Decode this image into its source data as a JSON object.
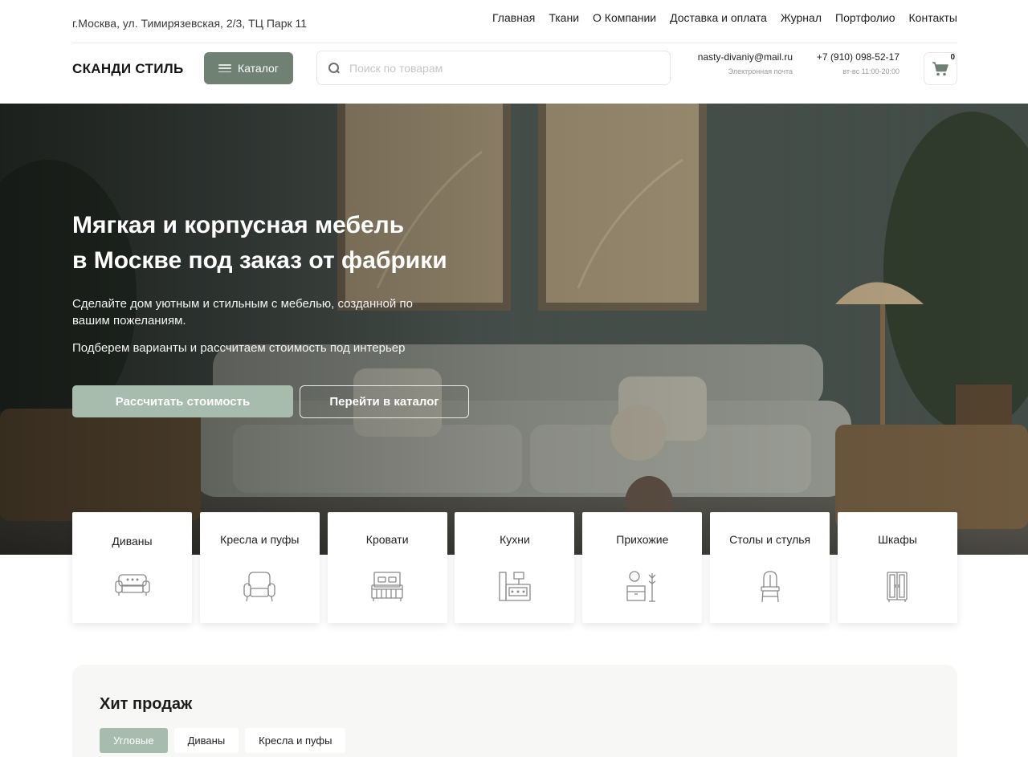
{
  "topbar": {
    "address": "г.Москва, ул. Тимирязевская, 2/3, ТЦ Парк 11",
    "nav": [
      "Главная",
      "Ткани",
      "О Компании",
      "Доставка и оплата",
      "Журнал",
      "Портфолио",
      "Контакты"
    ]
  },
  "header": {
    "logo": "СКАНДИ СТИЛЬ",
    "catalog_label": "Каталог",
    "search_placeholder": "Поиск по товарам",
    "email": "nasty-divaniy@mail.ru",
    "email_caption": "Электронная почта",
    "phone": "+7 (910) 098-52-17",
    "phone_caption": "вт-вс 11:00-20:00",
    "cart_count": "0"
  },
  "hero": {
    "title_line1": "Мягкая и корпусная мебель",
    "title_line2": "в Москве под заказ от фабрики",
    "subtitle": "Сделайте дом уютным и стильным с мебелью, созданной по вашим пожеланиям.",
    "subtitle2": "Подберем варианты и рассчитаем стоимость под интерьер",
    "btn_primary": "Рассчитать стоимость",
    "btn_secondary": "Перейти в каталог"
  },
  "categories": [
    {
      "label": "Диваны",
      "icon": "sofa-icon"
    },
    {
      "label": "Кресла и пуфы",
      "icon": "armchair-icon"
    },
    {
      "label": "Кровати",
      "icon": "bed-icon"
    },
    {
      "label": "Кухни",
      "icon": "kitchen-icon"
    },
    {
      "label": "Прихожие",
      "icon": "hallway-icon"
    },
    {
      "label": "Столы и стулья",
      "icon": "chair-icon"
    },
    {
      "label": "Шкафы",
      "icon": "wardrobe-icon"
    }
  ],
  "hits": {
    "title": "Хит продаж",
    "tabs": [
      "Угловые",
      "Диваны",
      "Кресла и пуфы"
    ]
  },
  "colors": {
    "accent": "#6f8172",
    "accent_light": "#a7bcad"
  }
}
